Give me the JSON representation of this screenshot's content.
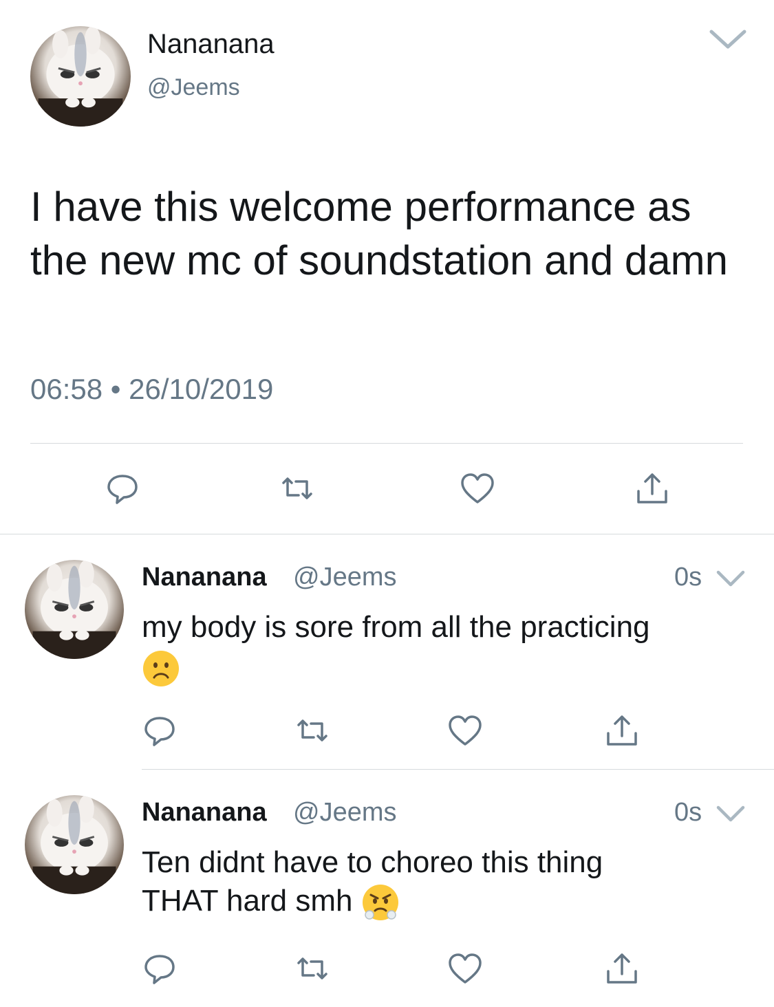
{
  "main_tweet": {
    "display_name": "Nananana",
    "handle": "@Jeems",
    "text": "I have this welcome performance as the new mc of soundstation and damn",
    "timestamp": "06:58 • 26/10/2019",
    "avatar_icon": "white-bunny-avatar",
    "actions": [
      "reply-icon",
      "retweet-icon",
      "like-icon",
      "share-icon"
    ]
  },
  "replies": [
    {
      "display_name": "Nananana",
      "handle": "@Jeems",
      "time": "0s",
      "text": "my body is sore from all the practicing",
      "emoji": "frowning-face-emoji",
      "avatar_icon": "white-bunny-avatar"
    },
    {
      "display_name": "Nananana",
      "handle": "@Jeems",
      "time": "0s",
      "text": "Ten didnt have to choreo this thing THAT hard smh",
      "emoji": "steam-from-nose-emoji",
      "avatar_icon": "white-bunny-avatar"
    }
  ],
  "colors": {
    "primary_text": "#14171a",
    "secondary_text": "#657786",
    "icon": "#657786",
    "divider": "#d6dadd"
  }
}
